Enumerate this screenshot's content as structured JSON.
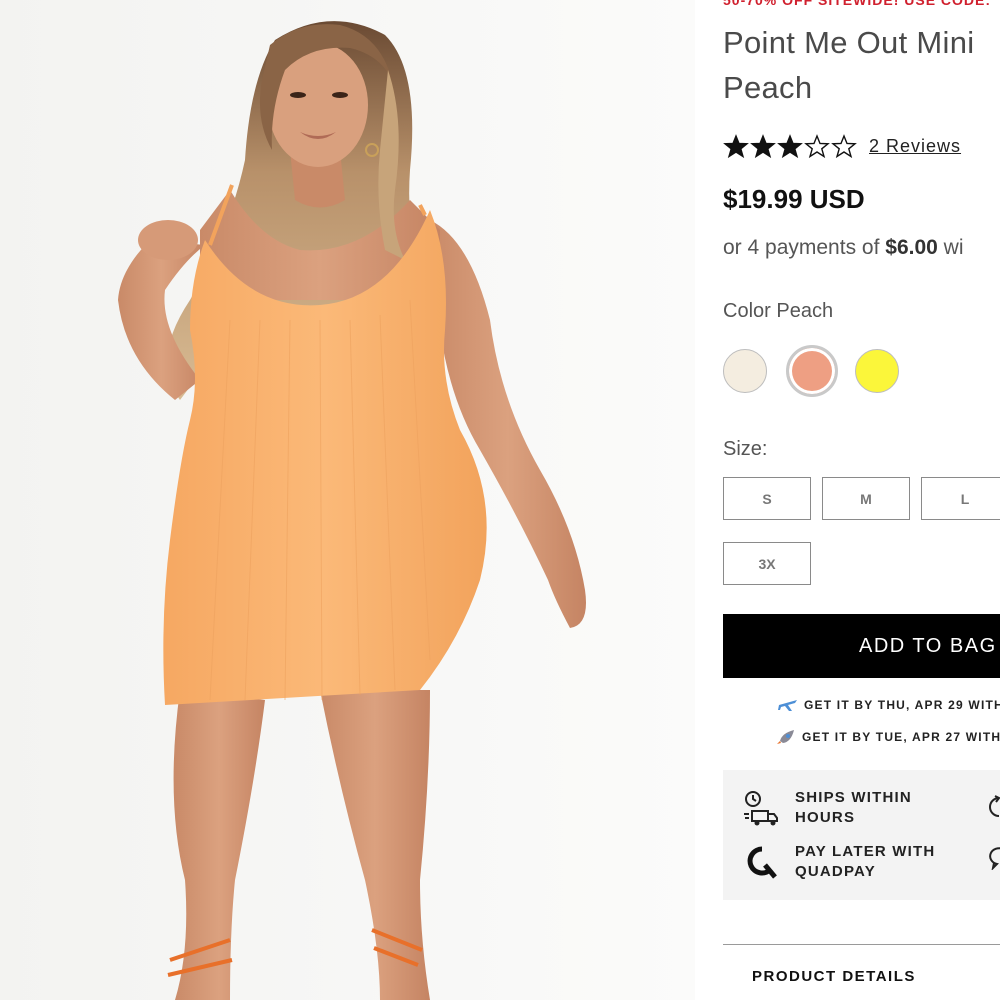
{
  "promo_banner": "50-70% OFF SITEWIDE! USE CODE:",
  "product": {
    "title_line1": "Point Me Out Mini",
    "title_line2": "Peach",
    "rating_value": 3,
    "rating_max": 5,
    "reviews_label": "2 Reviews",
    "price": "$19.99 USD",
    "installments_prefix": "or 4 payments of",
    "installments_amount": "$6.00",
    "installments_suffix": "wi"
  },
  "color": {
    "label": "Color",
    "selected": "Peach",
    "swatches": [
      {
        "name": "cream-swatch",
        "hex": "#f4ede0"
      },
      {
        "name": "peach-swatch",
        "hex": "#ee9f83"
      },
      {
        "name": "yellow-swatch",
        "hex": "#fbf63a"
      }
    ]
  },
  "size": {
    "label": "Size:",
    "options": [
      "S",
      "M",
      "L",
      "3X"
    ]
  },
  "add_to_bag_label": "ADD TO BAG",
  "shipping": {
    "line1": "GET IT BY THU, APR 29 WITH",
    "line2": "GET IT BY TUE, APR 27 WITH"
  },
  "features": {
    "ships_line1": "SHIPS WITHIN",
    "ships_line2": "HOURS",
    "pay_line1": "PAY LATER WITH",
    "pay_line2": "QUADPAY"
  },
  "product_details_label": "PRODUCT DETAILS",
  "colors": {
    "promo_red": "#d0202e",
    "button_black": "#000000",
    "dress_orange": "#f7b36e"
  }
}
